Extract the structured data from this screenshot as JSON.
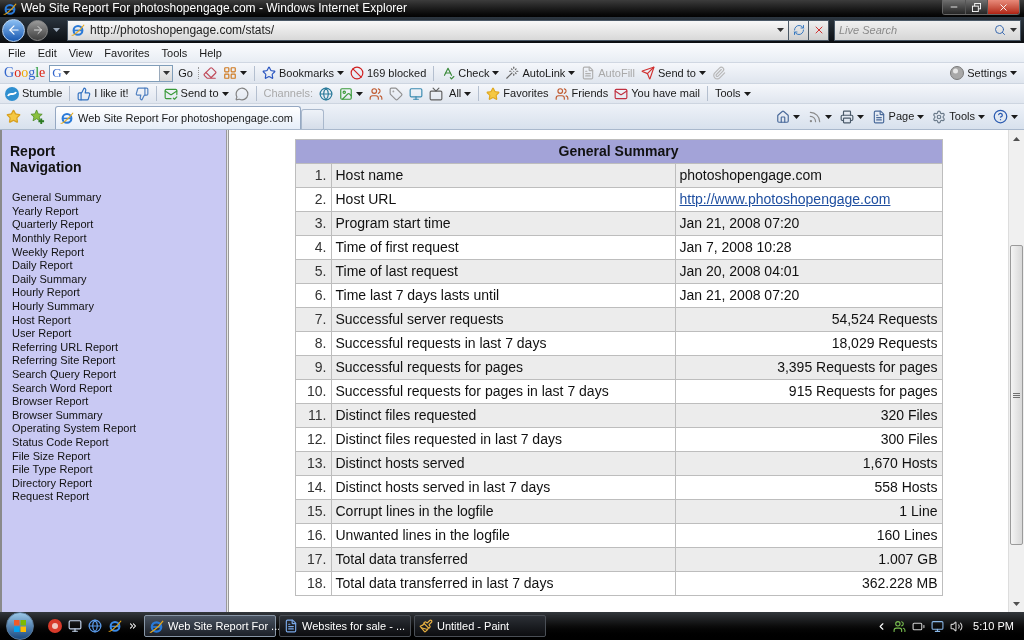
{
  "window": {
    "title": "Web Site Report For photoshopengage.com - Windows Internet Explorer"
  },
  "address_bar": {
    "value": "http://photoshopengage.com/stats/"
  },
  "search_box": {
    "placeholder": "Live Search"
  },
  "menu_bar": [
    "File",
    "Edit",
    "View",
    "Favorites",
    "Tools",
    "Help"
  ],
  "google_toolbar": {
    "logo": "Google",
    "engine": "G",
    "go": "Go",
    "groups": [
      [
        {
          "label": "Bookmarks",
          "dropdown": true,
          "disabled": false
        },
        {
          "label": "169 blocked",
          "dropdown": false,
          "disabled": false
        }
      ],
      [
        {
          "label": "Check",
          "dropdown": true,
          "disabled": false
        },
        {
          "label": "AutoLink",
          "dropdown": true,
          "disabled": false
        },
        {
          "label": "AutoFill",
          "dropdown": false,
          "disabled": true
        },
        {
          "label": "Send to",
          "dropdown": true,
          "disabled": false
        }
      ]
    ],
    "settings": {
      "label": "Settings",
      "dropdown": true
    }
  },
  "stumble_toolbar": {
    "groups": [
      [
        {
          "label": "Stumble",
          "dropdown": false,
          "disabled": false
        }
      ],
      [
        {
          "label": "I like it!",
          "dropdown": false,
          "disabled": false
        }
      ],
      [
        {
          "label": "Send to",
          "dropdown": true,
          "disabled": false
        }
      ],
      [
        {
          "label": "Channels:",
          "dropdown": false,
          "disabled": true
        },
        {
          "label": "All",
          "dropdown": true,
          "disabled": false
        }
      ],
      [
        {
          "label": "Favorites",
          "dropdown": false,
          "disabled": false
        },
        {
          "label": "Friends",
          "dropdown": false,
          "disabled": false
        },
        {
          "label": "You have mail",
          "dropdown": false,
          "disabled": false
        }
      ],
      [
        {
          "label": "Tools",
          "dropdown": true,
          "disabled": false
        }
      ]
    ]
  },
  "tabs": [
    {
      "label": "Web Site Report For photoshopengage.com",
      "selected": true
    }
  ],
  "command_bar": [
    {
      "label": "Page",
      "dropdown": true
    },
    {
      "label": "Tools",
      "dropdown": true
    }
  ],
  "sidebar": {
    "title": "Report Navigation",
    "items": [
      "General Summary",
      "Yearly Report",
      "Quarterly Report",
      "Monthly Report",
      "Weekly Report",
      "Daily Report",
      "Daily Summary",
      "Hourly Report",
      "Hourly Summary",
      "Host Report",
      "User Report",
      "Referring URL Report",
      "Referring Site Report",
      "Search Query Report",
      "Search Word Report",
      "Browser Report",
      "Browser Summary",
      "Operating System Report",
      "Status Code Report",
      "File Size Report",
      "File Type Report",
      "Directory Report",
      "Request Report"
    ]
  },
  "summary_table": {
    "title": "General Summary",
    "rows": [
      {
        "number": "1.",
        "label": "Host name",
        "value": "photoshopengage.com",
        "kind": "text"
      },
      {
        "number": "2.",
        "label": "Host URL",
        "value": "http://www.photoshopengage.com",
        "kind": "link"
      },
      {
        "number": "3.",
        "label": "Program start time",
        "value": "Jan 21, 2008 07:20",
        "kind": "text"
      },
      {
        "number": "4.",
        "label": "Time of first request",
        "value": "Jan 7, 2008 10:28",
        "kind": "text"
      },
      {
        "number": "5.",
        "label": "Time of last request",
        "value": "Jan 20, 2008 04:01",
        "kind": "text"
      },
      {
        "number": "6.",
        "label": "Time last 7 days lasts until",
        "value": "Jan 21, 2008 07:20",
        "kind": "text"
      },
      {
        "number": "7.",
        "label": "Successful server requests",
        "value": "54,524 Requests",
        "kind": "count"
      },
      {
        "number": "8.",
        "label": "Successful requests in last 7 days",
        "value": "18,029 Requests",
        "kind": "count"
      },
      {
        "number": "9.",
        "label": "Successful requests for pages",
        "value": "3,395 Requests for pages",
        "kind": "count"
      },
      {
        "number": "10.",
        "label": "Successful requests for pages in last 7 days",
        "value": "915 Requests for pages",
        "kind": "count"
      },
      {
        "number": "11.",
        "label": "Distinct files requested",
        "value": "320 Files",
        "kind": "count"
      },
      {
        "number": "12.",
        "label": "Distinct files requested in last 7 days",
        "value": "300 Files",
        "kind": "count"
      },
      {
        "number": "13.",
        "label": "Distinct hosts served",
        "value": "1,670 Hosts",
        "kind": "count"
      },
      {
        "number": "14.",
        "label": "Distinct hosts served in last 7 days",
        "value": "558 Hosts",
        "kind": "count"
      },
      {
        "number": "15.",
        "label": "Corrupt lines in the logfile",
        "value": "1 Line",
        "kind": "count"
      },
      {
        "number": "16.",
        "label": "Unwanted lines in the logfile",
        "value": "160 Lines",
        "kind": "count"
      },
      {
        "number": "17.",
        "label": "Total data transferred",
        "value": "1.007 GB",
        "kind": "count"
      },
      {
        "number": "18.",
        "label": "Total data transferred in last 7 days",
        "value": "362.228 MB",
        "kind": "count"
      }
    ]
  },
  "taskbar": {
    "buttons": [
      {
        "label": "Web Site Report For ...",
        "selected": true
      },
      {
        "label": "Websites for sale - ...",
        "selected": false
      },
      {
        "label": "Untitled - Paint",
        "selected": false
      }
    ],
    "clock": "5:10 PM"
  }
}
